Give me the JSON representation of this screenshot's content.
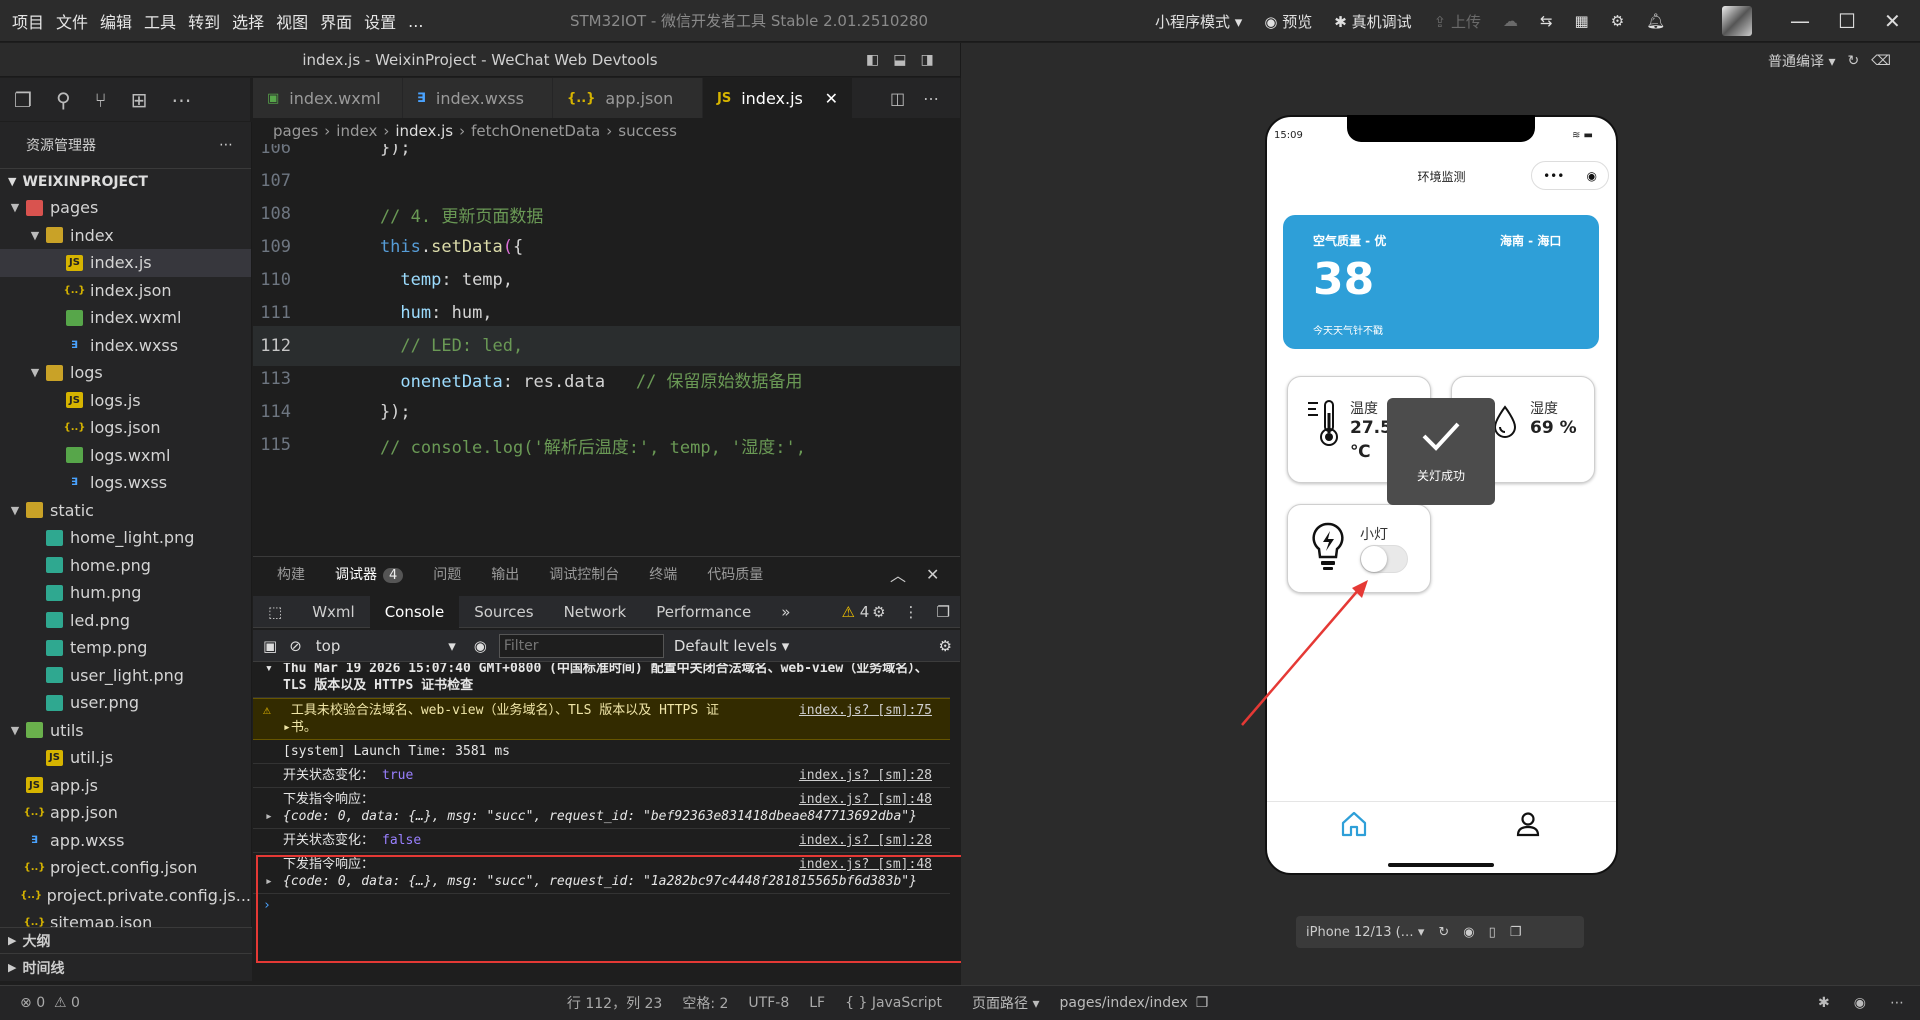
{
  "menubar": {
    "items": [
      "项目",
      "文件",
      "编辑",
      "工具",
      "转到",
      "选择",
      "视图",
      "界面",
      "设置",
      "..."
    ],
    "app_title": "STM32IOT - 微信开发者工具 Stable 2.01.2510280"
  },
  "toolbar": {
    "mode": "小程序模式",
    "preview": "预览",
    "debug": "真机调试",
    "upload": "上传"
  },
  "editor": {
    "window_title": "index.js - WeixinProject - WeChat Web Devtools",
    "tabs": [
      {
        "label": "index.wxml",
        "icon": "wxml"
      },
      {
        "label": "index.wxss",
        "icon": "wxss"
      },
      {
        "label": "app.json",
        "icon": "json"
      },
      {
        "label": "index.js",
        "icon": "js"
      }
    ],
    "breadcrumb": [
      "pages",
      "index",
      "index.js",
      "fetchOnenetData",
      "success"
    ]
  },
  "explorer": {
    "title": "资源管理器",
    "project": "WEIXINPROJECT",
    "tree": [
      {
        "label": "pages",
        "icon": "folder-red",
        "depth": 1,
        "open": true
      },
      {
        "label": "index",
        "icon": "folder",
        "depth": 2,
        "open": true
      },
      {
        "label": "index.js",
        "icon": "js",
        "depth": 3,
        "selected": true
      },
      {
        "label": "index.json",
        "icon": "json",
        "depth": 3
      },
      {
        "label": "index.wxml",
        "icon": "wxml",
        "depth": 3
      },
      {
        "label": "index.wxss",
        "icon": "wxss",
        "depth": 3
      },
      {
        "label": "logs",
        "icon": "folder",
        "depth": 2,
        "open": true
      },
      {
        "label": "logs.js",
        "icon": "js",
        "depth": 3
      },
      {
        "label": "logs.json",
        "icon": "json",
        "depth": 3
      },
      {
        "label": "logs.wxml",
        "icon": "wxml",
        "depth": 3
      },
      {
        "label": "logs.wxss",
        "icon": "wxss",
        "depth": 3
      },
      {
        "label": "static",
        "icon": "folder",
        "depth": 1,
        "open": true
      },
      {
        "label": "home_light.png",
        "icon": "png",
        "depth": 2
      },
      {
        "label": "home.png",
        "icon": "png",
        "depth": 2
      },
      {
        "label": "hum.png",
        "icon": "png",
        "depth": 2
      },
      {
        "label": "led.png",
        "icon": "png",
        "depth": 2
      },
      {
        "label": "temp.png",
        "icon": "png",
        "depth": 2
      },
      {
        "label": "user_light.png",
        "icon": "png",
        "depth": 2
      },
      {
        "label": "user.png",
        "icon": "png",
        "depth": 2
      },
      {
        "label": "utils",
        "icon": "folder-green",
        "depth": 1,
        "open": true
      },
      {
        "label": "util.js",
        "icon": "js",
        "depth": 2
      },
      {
        "label": "app.js",
        "icon": "js",
        "depth": 1
      },
      {
        "label": "app.json",
        "icon": "json",
        "depth": 1
      },
      {
        "label": "app.wxss",
        "icon": "wxss",
        "depth": 1
      },
      {
        "label": "project.config.json",
        "icon": "json",
        "depth": 1
      },
      {
        "label": "project.private.config.js...",
        "icon": "json",
        "depth": 1
      },
      {
        "label": "sitemap.json",
        "icon": "json",
        "depth": 1
      }
    ],
    "outline": "大纲",
    "timeline": "时间线"
  },
  "code": {
    "current_line": "112",
    "lines": [
      {
        "n": "106",
        "html": "<span class='tx'>    });</span>"
      },
      {
        "n": "107",
        "html": ""
      },
      {
        "n": "108",
        "html": "<span class='cm'>    // 4. 更新页面数据</span>"
      },
      {
        "n": "109",
        "html": "<span class='kw'>    this</span><span class='tx'>.</span><span class='fn'>setData</span><span class='br'>(</span><span class='tx'>{</span>"
      },
      {
        "n": "110",
        "html": "<span class='pr'>      temp</span><span class='tx'>: temp,</span>"
      },
      {
        "n": "111",
        "html": "<span class='pr'>      hum</span><span class='tx'>: hum,</span>"
      },
      {
        "n": "112",
        "html": "<span class='cm'>      // LED: led,</span>"
      },
      {
        "n": "113",
        "html": "<span class='pr'>      onenetData</span><span class='tx'>: res.data   </span><span class='cm'>// 保留原始数据备用</span>"
      },
      {
        "n": "114",
        "html": "<span class='tx'>    })</span><span class='tx'>;</span>"
      },
      {
        "n": "115",
        "html": "<span class='cm'>    // console.log('解析后温度:', temp, '湿度:',</span>"
      }
    ]
  },
  "panel": {
    "tabs": [
      "构建",
      "调试器",
      "问题",
      "输出",
      "调试控制台",
      "终端",
      "代码质量"
    ],
    "debugger_badge": "4",
    "devtools_tabs": [
      "Wxml",
      "Console",
      "Sources",
      "Network",
      "Performance",
      "»"
    ],
    "warn_count": "4",
    "context": "top",
    "filter_placeholder": "Filter",
    "levels": "Default levels",
    "logs": [
      {
        "type": "info",
        "text": "Thu Mar 19 2026 15:07:40 GMT+0800 (中国标准时间) 配置中关闭合法域名、web-view（业务域名）、TLS 版本以及 HTTPS 证书检查",
        "src": ""
      },
      {
        "type": "warn",
        "text": "工具未校验合法域名、web-view（业务域名）、TLS 版本以及 HTTPS 证书。",
        "src": "index.js? [sm]:75"
      },
      {
        "type": "log",
        "text": "[system] Launch Time: 3581 ms",
        "src": ""
      },
      {
        "type": "log",
        "text": "开关状态变化：",
        "value": "true",
        "src": "index.js? [sm]:28"
      },
      {
        "type": "log",
        "text": "下发指令响应：",
        "obj": "{code: 0, data: {…}, msg: \"succ\", request_id: \"bef92363e831418dbeae847713692dba\"}",
        "src": "index.js? [sm]:48"
      },
      {
        "type": "log",
        "text": "开关状态变化：",
        "value": "false",
        "src": "index.js? [sm]:28"
      },
      {
        "type": "log",
        "text": "下发指令响应：",
        "obj": "{code: 0, data: {…}, msg: \"succ\", request_id: \"1a282bc97c4448f281815565bf6d383b\"}",
        "src": "index.js? [sm]:48"
      }
    ]
  },
  "statusbar": {
    "errors": "0",
    "warnings": "0",
    "position": "行 112，列 23",
    "indent": "空格: 2",
    "encoding": "UTF-8",
    "eol": "LF",
    "language": "JavaScript",
    "page_path_label": "页面路径",
    "page_path": "pages/index/index"
  },
  "simulator": {
    "compile_mode": "普通编译",
    "time": "15:09",
    "nav_title": "环境监测",
    "air_quality_label": "空气质量 - 优",
    "location": "海南 - 海口",
    "aqi": "38",
    "weather_desc": "今天天气针不戳",
    "temp_label": "温度",
    "temp_value": "27.5",
    "temp_unit": "℃",
    "hum_label": "湿度",
    "hum_value": "69 %",
    "led_label": "小灯",
    "led_on": false,
    "toast": "关灯成功",
    "device": "iPhone 12/13 (…"
  },
  "colors": {
    "aircard": "#2e9fd8",
    "accent_tab": "#2e9fd8",
    "highlight_box": "#e53935"
  }
}
